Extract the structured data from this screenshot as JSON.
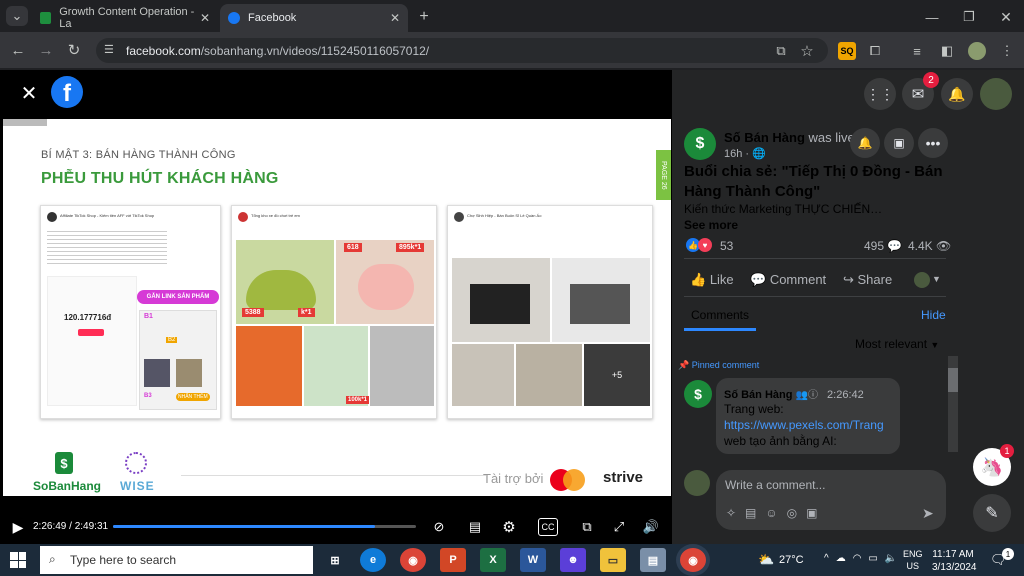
{
  "browser": {
    "tabs": [
      {
        "title": "Growth Content Operation - La"
      },
      {
        "title": "Facebook"
      }
    ],
    "url_domain": "facebook.com",
    "url_path": "/sobanhang.vn/videos/1152450116057012/"
  },
  "slide": {
    "heading_small": "BÍ MẬT 3: BÁN HÀNG THÀNH CÔNG",
    "heading_big": "PHỄU THU HÚT KHÁCH HÀNG",
    "page_tag": "PAGE 26",
    "card1": {
      "author": "Affiliate TikTok Shop - Kiếm tiền AFF với TikTok Shop",
      "price": "120.177716đ",
      "tag": "GẮN LINK SẢN PHẨM",
      "b1": "B1",
      "b2": "B2",
      "b3": "B3",
      "nhan_them": "NHẤN THÊM"
    },
    "card2": {
      "author": "Tổng kho xe đồ chơi trẻ em",
      "price1": "618",
      "price2": "895k*1",
      "price3": "5388",
      "price4": "k*1",
      "price5": "100k*1"
    },
    "card3": {
      "author": "Chợ Sỉnh Hiệp - Bán Buôn Sỉ Lẻ Quần Áo",
      "more": "+5"
    },
    "brand_left": "SoBanHang",
    "brand_mid": "WISE",
    "sponsor_label": "Tài trợ bởi",
    "sponsor_name": "strive"
  },
  "player": {
    "current": "2:26:49",
    "separator": "/",
    "duration": "2:49:31",
    "progress": 0.865
  },
  "panel": {
    "notif_count": "2",
    "page_name": "Số Bán Hàng",
    "was_live": "was live.",
    "time_ago": "16h",
    "title": "Buổi chia sẻ: \"Tiếp Thị 0 Đồng - Bán Hàng Thành Công\"",
    "desc": "Kiến thức Marketing THỰC CHIẾN…",
    "see_more": "See more",
    "reactions": "53",
    "comments_count": "495",
    "views": "4.4K",
    "like": "Like",
    "comment": "Comment",
    "share": "Share",
    "comments_tab": "Comments",
    "hide": "Hide",
    "most_relevant": "Most relevant",
    "pinned": "Pinned comment",
    "c_author": "Số Bán Hàng",
    "c_time": "2:26:42",
    "c_line1": "Trang web:",
    "c_link": "https://www.pexels.com/Trang",
    "c_line3": "web tạo ảnh bằng AI:",
    "write_placeholder": "Write a comment...",
    "chat_badge": "1"
  },
  "taskbar": {
    "search": "Type here to search",
    "temp": "27°C",
    "lang1": "ENG",
    "lang2": "US",
    "time": "11:17 AM",
    "date": "3/13/2024",
    "notif": "1"
  }
}
